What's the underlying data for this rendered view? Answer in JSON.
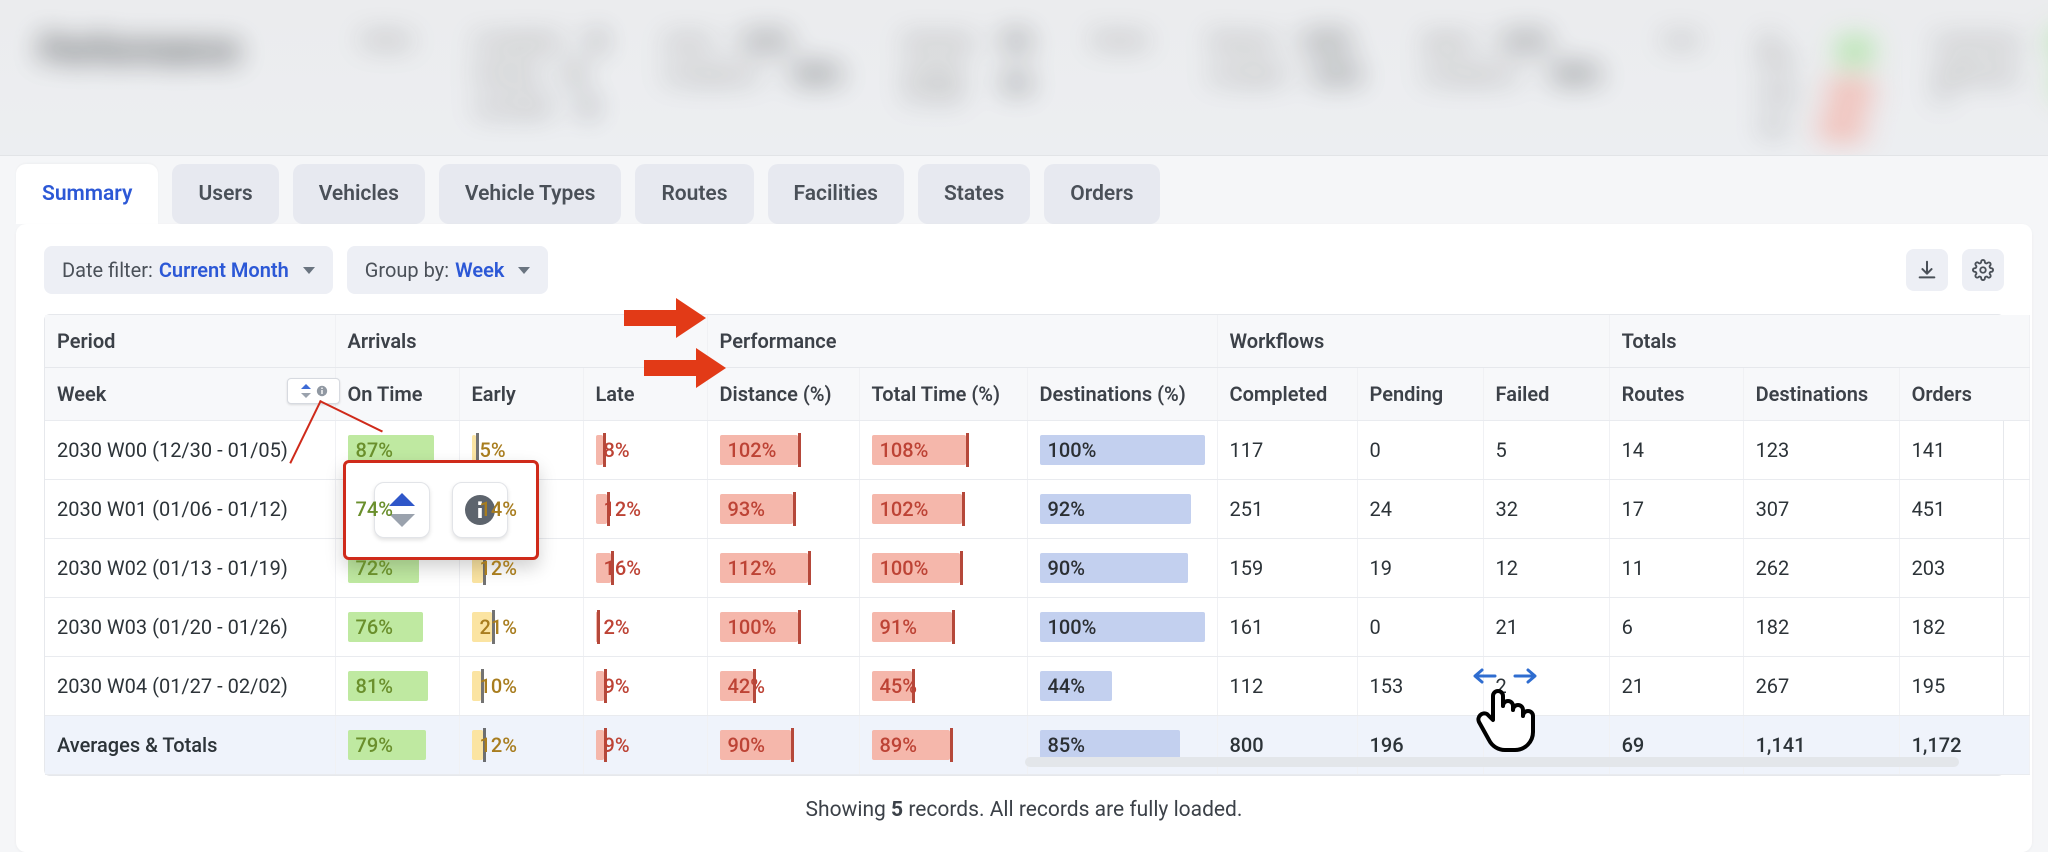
{
  "tabs": [
    "Summary",
    "Users",
    "Vehicles",
    "Vehicle Types",
    "Routes",
    "Facilities",
    "States",
    "Orders"
  ],
  "active_tab": 0,
  "filters": {
    "date_label": "Date filter:",
    "date_value": "Current Month",
    "group_label": "Group by:",
    "group_value": "Week"
  },
  "column_groups": {
    "period": "Period",
    "arrivals": "Arrivals",
    "performance": "Performance",
    "workflows": "Workflows",
    "totals": "Totals"
  },
  "columns": {
    "week": "Week",
    "on_time": "On Time",
    "early": "Early",
    "late": "Late",
    "distance": "Distance (%)",
    "total_time": "Total Time (%)",
    "destinations_pct": "Destinations (%)",
    "completed": "Completed",
    "pending": "Pending",
    "failed": "Failed",
    "routes": "Routes",
    "destinations": "Destinations",
    "orders": "Orders"
  },
  "rows": [
    {
      "period": "2030 W00 (12/30 - 01/05)",
      "on_time": {
        "text": "87%",
        "fill": 87
      },
      "early": {
        "text": "5%",
        "fill": 5
      },
      "late": {
        "text": "8%",
        "fill": 8
      },
      "distance": {
        "text": "102%",
        "fill": 62
      },
      "total_time": {
        "text": "108%",
        "fill": 66
      },
      "dest_pct": {
        "text": "100%",
        "fill": 100
      },
      "completed": "117",
      "pending": "0",
      "failed": "5",
      "routes": "14",
      "destinations": "123",
      "orders": "141"
    },
    {
      "period": "2030 W01 (01/06 - 01/12)",
      "on_time": {
        "text": "74%",
        "fill": 74
      },
      "early": {
        "text": "14%",
        "fill": 14
      },
      "late": {
        "text": "12%",
        "fill": 12
      },
      "distance": {
        "text": "93%",
        "fill": 58
      },
      "total_time": {
        "text": "102%",
        "fill": 63
      },
      "dest_pct": {
        "text": "92%",
        "fill": 92
      },
      "completed": "251",
      "pending": "24",
      "failed": "32",
      "routes": "17",
      "destinations": "307",
      "orders": "451"
    },
    {
      "period": "2030 W02 (01/13 - 01/19)",
      "on_time": {
        "text": "72%",
        "fill": 72
      },
      "early": {
        "text": "12%",
        "fill": 12
      },
      "late": {
        "text": "16%",
        "fill": 16
      },
      "distance": {
        "text": "112%",
        "fill": 70
      },
      "total_time": {
        "text": "100%",
        "fill": 62
      },
      "dest_pct": {
        "text": "90%",
        "fill": 90
      },
      "completed": "159",
      "pending": "19",
      "failed": "12",
      "routes": "11",
      "destinations": "262",
      "orders": "203"
    },
    {
      "period": "2030 W03 (01/20 - 01/26)",
      "on_time": {
        "text": "76%",
        "fill": 76
      },
      "early": {
        "text": "21%",
        "fill": 21
      },
      "late": {
        "text": "2%",
        "fill": 2
      },
      "distance": {
        "text": "100%",
        "fill": 62
      },
      "total_time": {
        "text": "91%",
        "fill": 56
      },
      "dest_pct": {
        "text": "100%",
        "fill": 100
      },
      "completed": "161",
      "pending": "0",
      "failed": "21",
      "routes": "6",
      "destinations": "182",
      "orders": "182"
    },
    {
      "period": "2030 W04 (01/27 - 02/02)",
      "on_time": {
        "text": "81%",
        "fill": 81
      },
      "early": {
        "text": "10%",
        "fill": 10
      },
      "late": {
        "text": "9%",
        "fill": 9
      },
      "distance": {
        "text": "42%",
        "fill": 26
      },
      "total_time": {
        "text": "45%",
        "fill": 28
      },
      "dest_pct": {
        "text": "44%",
        "fill": 44
      },
      "completed": "112",
      "pending": "153",
      "failed": "2",
      "routes": "21",
      "destinations": "267",
      "orders": "195"
    }
  ],
  "totals_row": {
    "period": "Averages & Totals",
    "on_time": {
      "text": "79%",
      "fill": 79
    },
    "early": {
      "text": "12%",
      "fill": 12
    },
    "late": {
      "text": "9%",
      "fill": 9
    },
    "distance": {
      "text": "90%",
      "fill": 56
    },
    "total_time": {
      "text": "89%",
      "fill": 55
    },
    "dest_pct": {
      "text": "85%",
      "fill": 85
    },
    "completed": "800",
    "pending": "196",
    "failed": "",
    "routes": "69",
    "destinations": "1,141",
    "orders": "1,172"
  },
  "footer": {
    "prefix": "Showing ",
    "count": "5",
    "suffix": " records. All records are fully loaded."
  }
}
